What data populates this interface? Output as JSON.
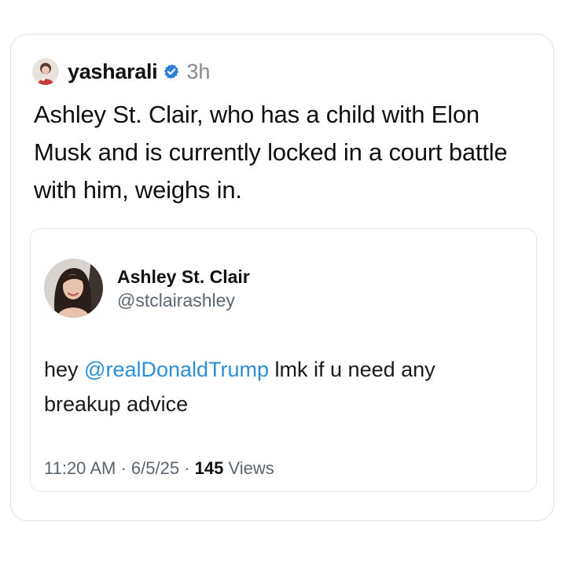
{
  "post": {
    "username": "yasharali",
    "time": "3h",
    "caption": "Ashley St. Clair, who has a child with Elon Musk and is currently locked in a court battle with him, weighs in.",
    "verified": true,
    "verified_color": "#2f7fd9"
  },
  "tweet": {
    "name": "Ashley St. Clair",
    "handle": "@stclairashley",
    "text_before": "hey ",
    "mention": "@realDonaldTrump",
    "text_after": " lmk if u need any breakup advice",
    "mention_color": "#2d8fd8",
    "time": "11:20 AM",
    "sep1": " · ",
    "date": "6/5/25",
    "sep2": " · ",
    "views_count": "145",
    "views_label": " Views"
  }
}
